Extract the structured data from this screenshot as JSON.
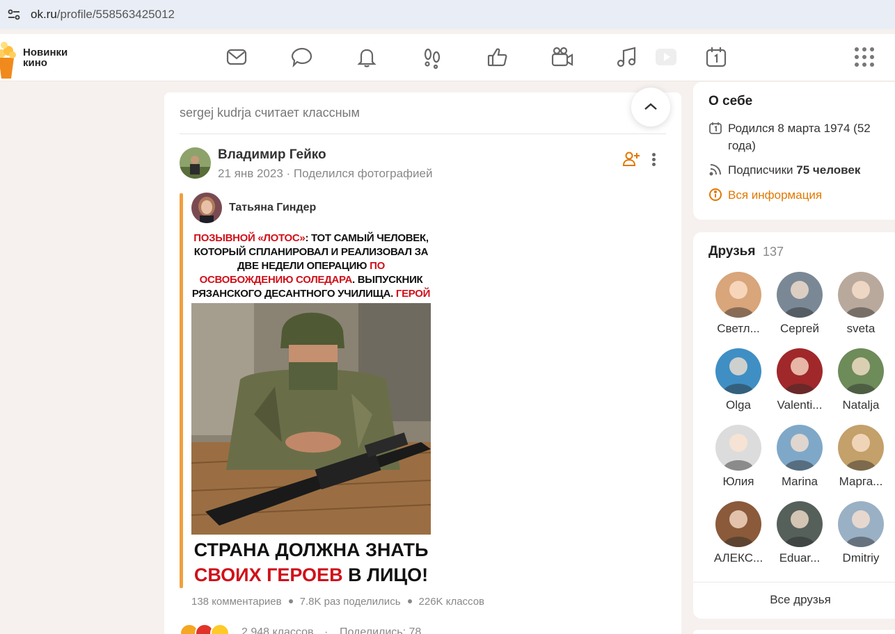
{
  "browser": {
    "url_domain": "ok.ru",
    "url_path": "/profile/558563425012"
  },
  "brand": {
    "label_line1": "Новинки",
    "label_line2": "кино"
  },
  "nav": {
    "icons": [
      "mail-icon",
      "chat-icon",
      "bell-icon",
      "footprints-icon",
      "thumbs-up-icon",
      "video-camera-icon",
      "music-note-icon",
      "play-icon",
      "calendar-icon"
    ]
  },
  "feed": {
    "liked_header": "sergej kudrja считает классным",
    "author": {
      "name": "Владимир Гейко",
      "date": "21 янв 2023",
      "action": "Поделился фотографией"
    },
    "repost": {
      "author": "Татьяна Гиндер",
      "headline_red1": "ПОЗЫВНОЙ «ЛОТОС»",
      "headline_text1": ": ТОТ САМЫЙ ЧЕЛОВЕК, КОТОРЫЙ СПЛАНИРОВАЛ И РЕАЛИЗОВАЛ ЗА ДВЕ НЕДЕЛИ ОПЕРАЦИЮ ",
      "headline_red2": "ПО ОСВОБОЖДЕНИЮ СОЛЕДАРА",
      "headline_text2": ". ВЫПУСКНИК РЯЗАНСКОГО ДЕСАНТНОГО УЧИЛИЩА. ",
      "headline_red3": "ГЕРОЙ РОССИИ",
      "bottom_line1": "СТРАНА ДОЛЖНА ЗНАТЬ",
      "bottom_red": "СВОИХ ГЕРОЕВ",
      "bottom_text": " В ЛИЦО!",
      "stats": {
        "comments": "138 комментариев",
        "shares": "7.8K раз поделились",
        "classes": "226K классов"
      }
    },
    "reactions_text": "2 948 классов",
    "shares_text": "Поделились: 78"
  },
  "about": {
    "title": "О себе",
    "birth": "Родился 8 марта 1974 (52 года)",
    "subscribers_label": "Подписчики ",
    "subscribers_value": "75 человек",
    "all_info": "Вся информация"
  },
  "friends": {
    "title": "Друзья",
    "count": "137",
    "items": [
      {
        "name": "Светл...",
        "color": "#d9a57a"
      },
      {
        "name": "Сергей",
        "color": "#7a8896"
      },
      {
        "name": "sveta",
        "color": "#b9a99c"
      },
      {
        "name": "Olga",
        "color": "#3f8fc4"
      },
      {
        "name": "Valenti...",
        "color": "#a0282a"
      },
      {
        "name": "Natalja",
        "color": "#6e8b5a"
      },
      {
        "name": "Юлия",
        "color": "#dcdcdc"
      },
      {
        "name": "Marina",
        "color": "#7fa8c8"
      },
      {
        "name": "Марга...",
        "color": "#c4a06a"
      },
      {
        "name": "АЛЕКС...",
        "color": "#8a5a3a"
      },
      {
        "name": "Eduar...",
        "color": "#55605a"
      },
      {
        "name": "Dmitriy",
        "color": "#9ab0c4"
      }
    ],
    "all_label": "Все друзья"
  }
}
